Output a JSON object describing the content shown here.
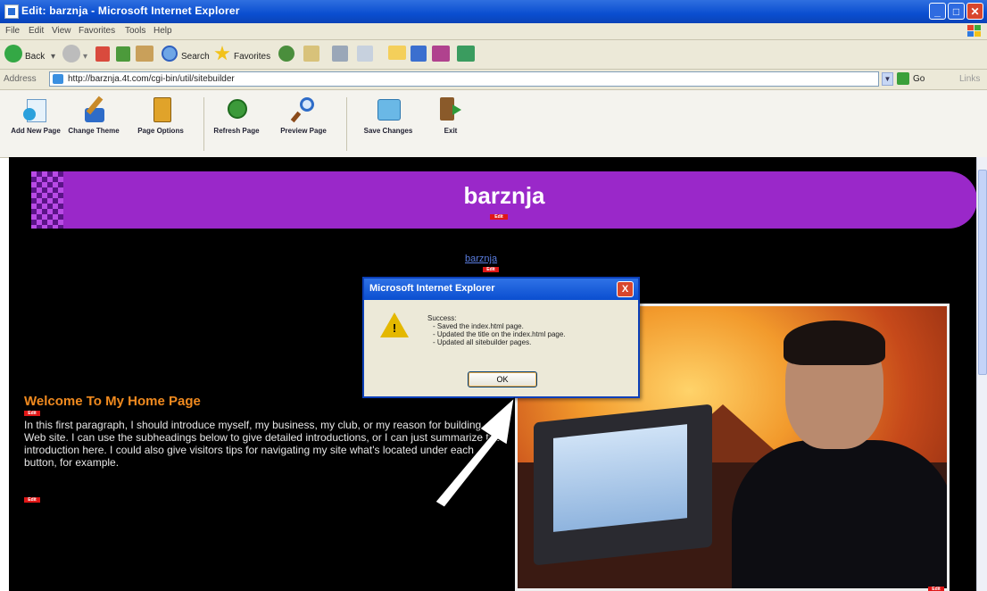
{
  "window": {
    "title": "Edit: barznja - Microsoft Internet Explorer"
  },
  "menu": [
    "File",
    "Edit",
    "View",
    "Favorites",
    "Tools",
    "Help"
  ],
  "toolbar": {
    "back": "Back",
    "search": "Search",
    "favorites": "Favorites"
  },
  "address": {
    "label": "Address",
    "url": "http://barznja.4t.com/cgi-bin/util/sitebuilder",
    "go": "Go",
    "links": "Links"
  },
  "sitebuilder": {
    "tools": [
      {
        "label": "Add New Page",
        "icon": "add-page-icon"
      },
      {
        "label": "Change Theme",
        "icon": "brush-icon"
      },
      {
        "label": "Page Options",
        "icon": "page-options-icon"
      },
      {
        "label": "Refresh Page",
        "icon": "refresh-icon"
      },
      {
        "label": "Preview Page",
        "icon": "magnifier-icon"
      },
      {
        "label": "Save Changes",
        "icon": "save-icon"
      },
      {
        "label": "Exit",
        "icon": "exit-door-icon"
      }
    ]
  },
  "site": {
    "title": "barznja",
    "nav_link": "barznja",
    "edit_badge": "Edit",
    "welcome_heading": "Welcome To My Home Page",
    "intro": "In this first paragraph, I should introduce myself, my business, my club, or my reason for building a Web site. I can use the subheadings below to give detailed introductions, or I can just summarize the introduction here. I could also give visitors tips for navigating my site what's located under each button, for example."
  },
  "dialog": {
    "title": "Microsoft Internet Explorer",
    "close": "X",
    "heading": "Success:",
    "lines": [
      "- Saved the index.html page.",
      "- Updated the title on the index.html page.",
      "- Updated all sitebuilder pages."
    ],
    "ok": "OK"
  },
  "colors": {
    "banner": "#9a28c9",
    "heading": "#f08a1f",
    "titlebar": "#0a4ed0"
  }
}
